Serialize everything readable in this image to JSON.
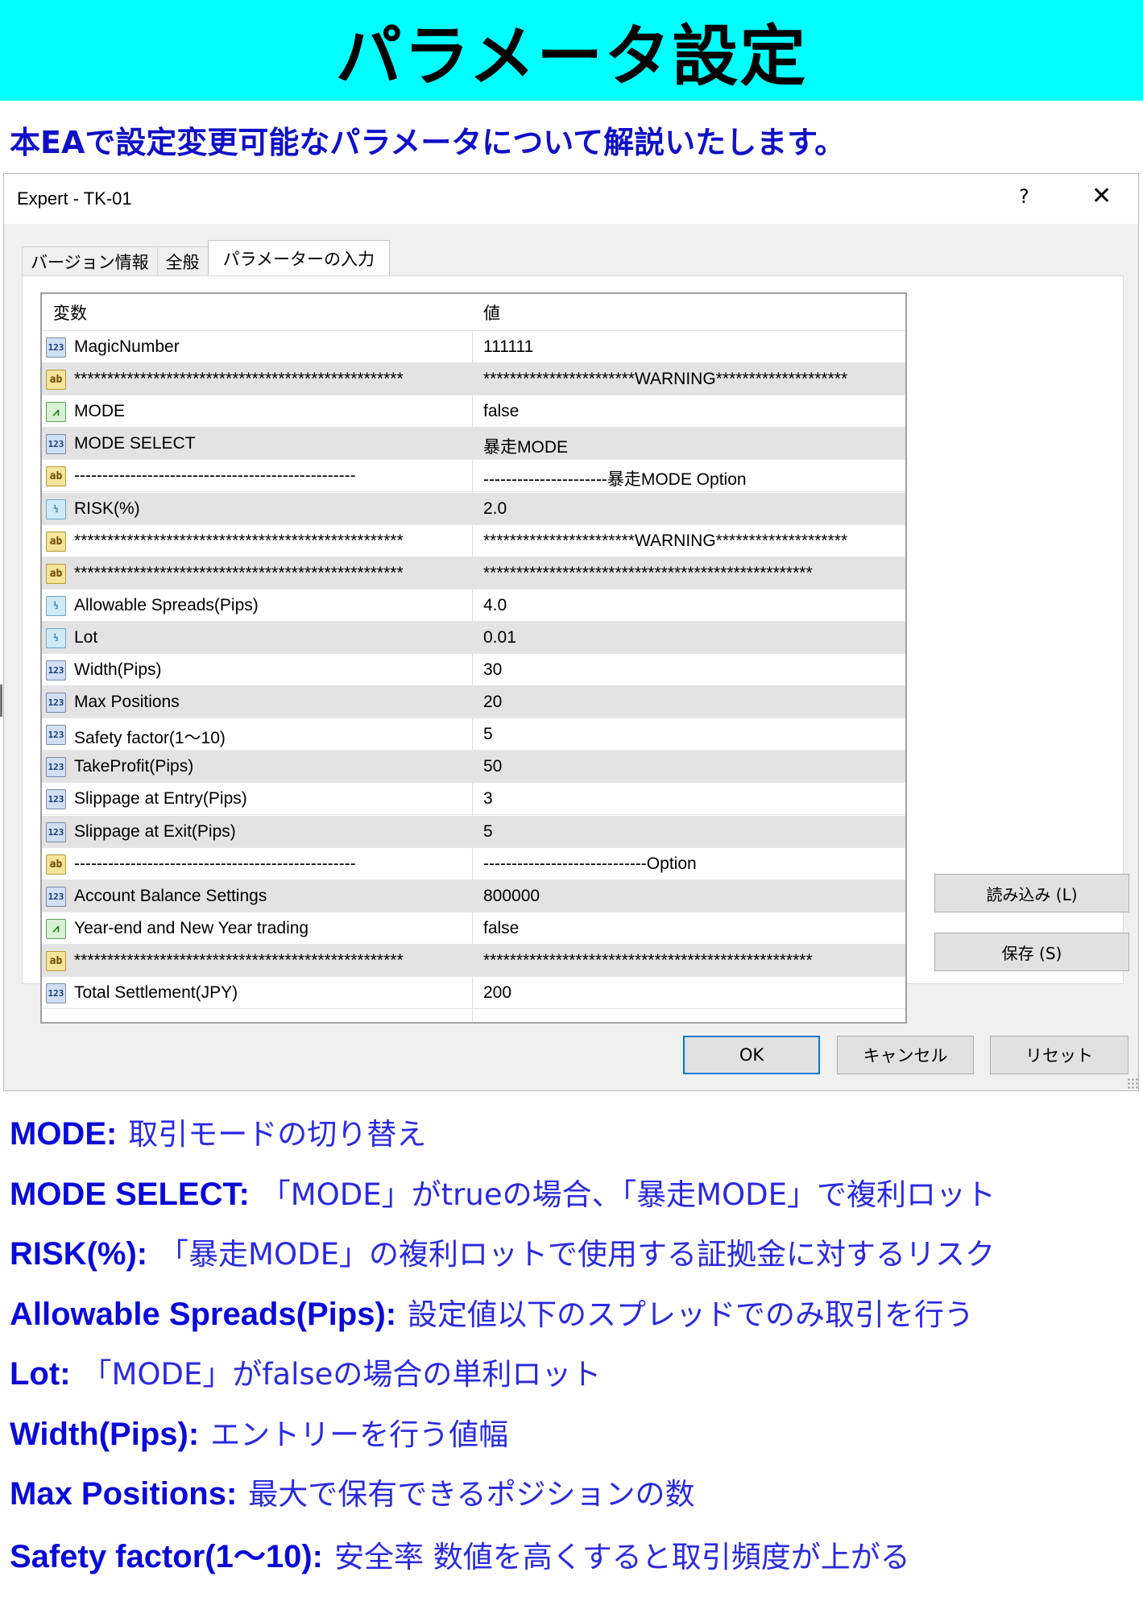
{
  "banner": {
    "title": "パラメータ設定"
  },
  "intro": "本EAで設定変更可能なパラメータについて解説いたします。",
  "dialog": {
    "title": "Expert - TK-01",
    "help": "?",
    "close": "✕",
    "tabs": [
      "バージョン情報",
      "全般",
      "パラメーターの入力"
    ],
    "columns": {
      "name": "変数",
      "value": "値"
    },
    "rows": [
      {
        "type": "int",
        "icon_text": "123",
        "name": "MagicNumber",
        "value": "111111"
      },
      {
        "type": "str",
        "icon_text": "ab",
        "name": "**************************************************",
        "value": "***********************WARNING********************"
      },
      {
        "type": "bool",
        "icon_text": "⩘",
        "name": "MODE",
        "value": "false"
      },
      {
        "type": "int",
        "icon_text": "123",
        "name": "MODE SELECT",
        "value": "暴走MODE"
      },
      {
        "type": "str",
        "icon_text": "ab",
        "name": "--------------------------------------------------",
        "value": "----------------------暴走MODE Option"
      },
      {
        "type": "dbl",
        "icon_text": "½",
        "name": "RISK(%)",
        "value": "2.0"
      },
      {
        "type": "str",
        "icon_text": "ab",
        "name": "**************************************************",
        "value": "***********************WARNING********************"
      },
      {
        "type": "str",
        "icon_text": "ab",
        "name": "**************************************************",
        "value": "**************************************************"
      },
      {
        "type": "dbl",
        "icon_text": "½",
        "name": "Allowable Spreads(Pips)",
        "value": "4.0"
      },
      {
        "type": "dbl",
        "icon_text": "½",
        "name": "Lot",
        "value": "0.01"
      },
      {
        "type": "int",
        "icon_text": "123",
        "name": "Width(Pips)",
        "value": "30"
      },
      {
        "type": "int",
        "icon_text": "123",
        "name": "Max Positions",
        "value": "20"
      },
      {
        "type": "int",
        "icon_text": "123",
        "name": "Safety factor(1～10)",
        "value": "5"
      },
      {
        "type": "int",
        "icon_text": "123",
        "name": "TakeProfit(Pips)",
        "value": "50"
      },
      {
        "type": "int",
        "icon_text": "123",
        "name": "Slippage at Entry(Pips)",
        "value": "3"
      },
      {
        "type": "int",
        "icon_text": "123",
        "name": "Slippage at Exit(Pips)",
        "value": "5"
      },
      {
        "type": "str",
        "icon_text": "ab",
        "name": "--------------------------------------------------",
        "value": "-----------------------------Option"
      },
      {
        "type": "int",
        "icon_text": "123",
        "name": "Account Balance Settings",
        "value": "800000"
      },
      {
        "type": "bool",
        "icon_text": "⩘",
        "name": "Year-end and New Year trading",
        "value": "false"
      },
      {
        "type": "str",
        "icon_text": "ab",
        "name": "**************************************************",
        "value": "**************************************************"
      },
      {
        "type": "int",
        "icon_text": "123",
        "name": "Total Settlement(JPY)",
        "value": "200"
      }
    ],
    "load_button": "読み込み (L)",
    "save_button": "保存 (S)",
    "ok_button": "OK",
    "cancel_button": "キャンセル",
    "reset_button": "リセット"
  },
  "descriptions": [
    {
      "key": "MODE:",
      "text": "取引モードの切り替え"
    },
    {
      "key": "MODE SELECT:",
      "text": "「MODE」がtrueの場合、「暴走MODE」で複利ロット"
    },
    {
      "key": "RISK(%):",
      "text": "「暴走MODE」の複利ロットで使用する証拠金に対するリスク"
    },
    {
      "key": "Allowable Spreads(Pips):",
      "text": "設定値以下のスプレッドでのみ取引を行う"
    },
    {
      "key": "Lot:",
      "text": "「MODE」がfalseの場合の単利ロット"
    },
    {
      "key": "Width(Pips):",
      "text": "エントリーを行う値幅"
    },
    {
      "key": "Max Positions:",
      "text": "最大で保有できるポジションの数"
    },
    {
      "key": "Safety factor(1～10):",
      "text": "安全率 数値を高くすると取引頻度が上がる"
    }
  ]
}
